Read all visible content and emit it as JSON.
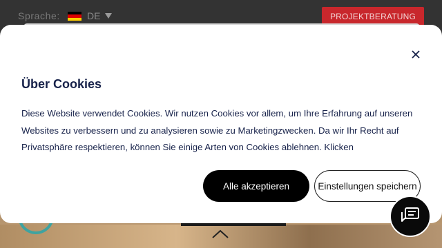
{
  "header": {
    "language_label": "Sprache:",
    "language_code": "DE",
    "cta_label": "PROJEKTBERATUNG"
  },
  "colors": {
    "cta": "#c8272c",
    "modal_text": "#17224a",
    "accept_bg": "#000000",
    "accent_teal": "#3fa3a0"
  },
  "icons": {
    "flag": "germany-flag-icon",
    "caret": "chevron-down-icon",
    "close": "close-icon",
    "chat": "chat-icon",
    "scroll": "chevron-up-icon",
    "grip": "drag-handle-icon"
  },
  "cookie_modal": {
    "title": "Über Cookies",
    "body": "Diese Website verwendet Cookies. Wir nutzen Cookies vor allem, um Ihre Erfahrung auf unseren Websites zu verbessern und zu analysieren sowie zu Marketingzwecken. Da wir Ihr Recht auf Privatsphäre respektieren, können Sie einige Arten von Cookies ablehnen. Klicken",
    "accept_label": "Alle akzeptieren",
    "save_label": "Einstellungen speichern"
  }
}
